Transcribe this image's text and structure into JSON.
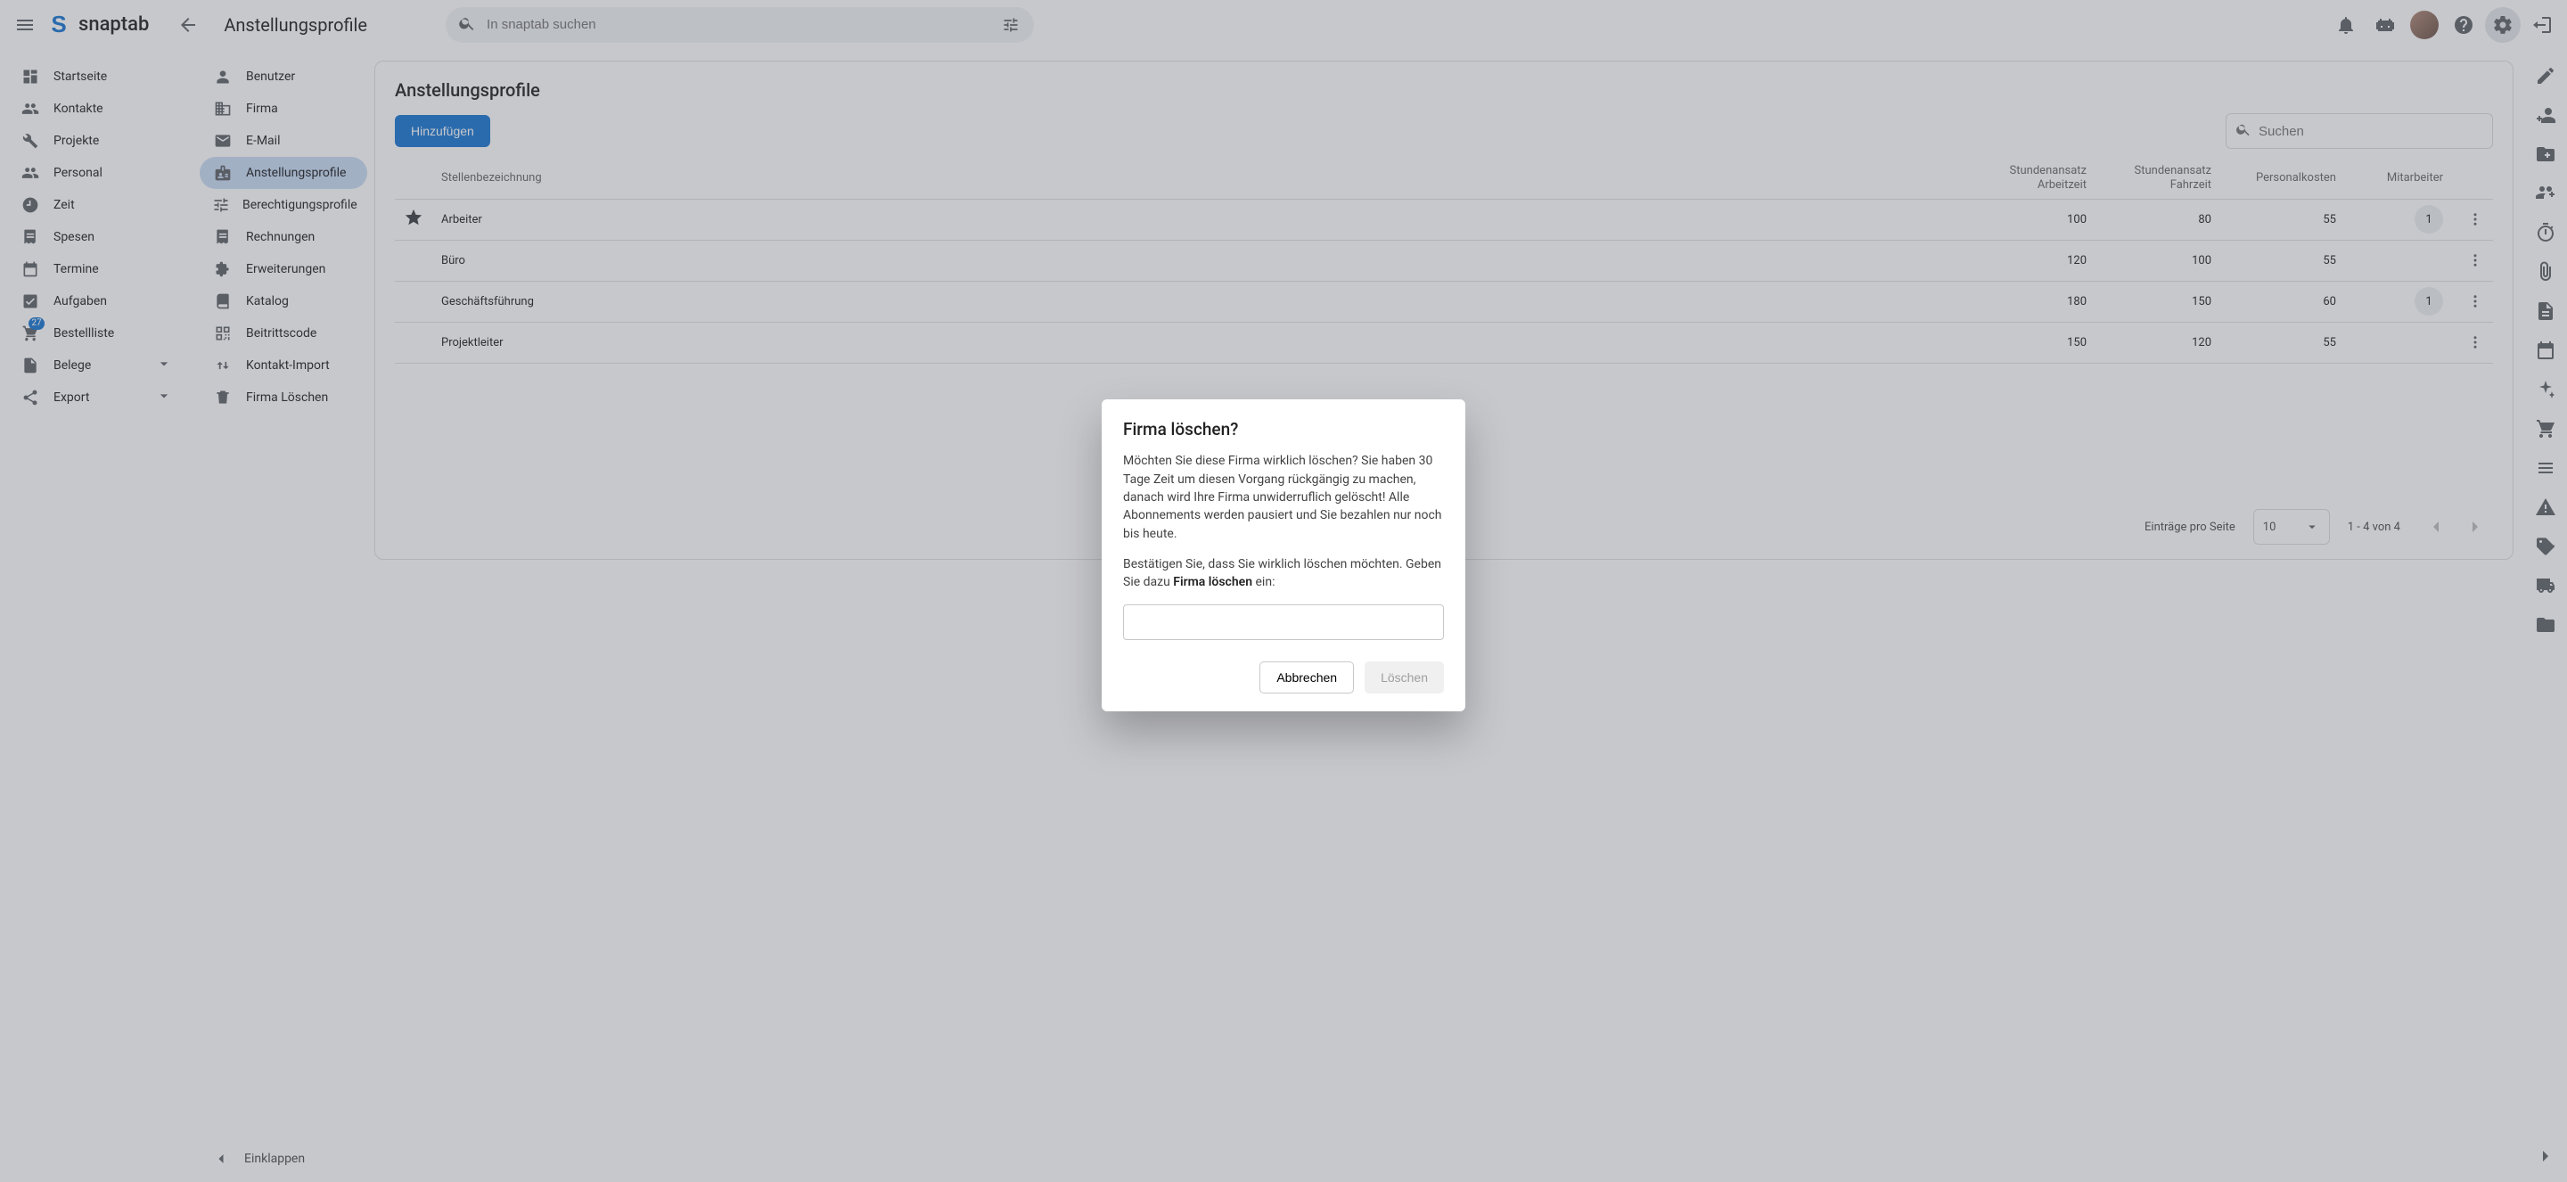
{
  "brand": {
    "word": "snaptab"
  },
  "topbar": {
    "page_title": "Anstellungsprofile",
    "search_placeholder": "In snaptab suchen"
  },
  "nav1": {
    "items": [
      {
        "label": "Startseite"
      },
      {
        "label": "Kontakte"
      },
      {
        "label": "Projekte"
      },
      {
        "label": "Personal"
      },
      {
        "label": "Zeit"
      },
      {
        "label": "Spesen"
      },
      {
        "label": "Termine"
      },
      {
        "label": "Aufgaben"
      },
      {
        "label": "Bestellliste",
        "badge": "27"
      },
      {
        "label": "Belege",
        "expandable": true
      },
      {
        "label": "Export",
        "expandable": true
      }
    ]
  },
  "nav2": {
    "items": [
      {
        "label": "Benutzer"
      },
      {
        "label": "Firma"
      },
      {
        "label": "E-Mail"
      },
      {
        "label": "Anstellungsprofile",
        "selected": true
      },
      {
        "label": "Berechtigungsprofile"
      },
      {
        "label": "Rechnungen"
      },
      {
        "label": "Erweiterungen"
      },
      {
        "label": "Katalog"
      },
      {
        "label": "Beitrittscode"
      },
      {
        "label": "Kontakt-Import"
      },
      {
        "label": "Firma Löschen"
      }
    ],
    "collapse_label": "Einklappen"
  },
  "content": {
    "heading": "Anstellungsprofile",
    "add_button": "Hinzufügen",
    "search_placeholder": "Suchen",
    "columns": {
      "title": "Stellenbezeichnung",
      "rate_work": "Stundenansatz\nArbeitzeit",
      "rate_drive": "Stundenansatz\nFahrzeit",
      "cost": "Personalkosten",
      "employees": "Mitarbeiter"
    },
    "rows": [
      {
        "starred": true,
        "title": "Arbeiter",
        "rate_work": "100",
        "rate_drive": "80",
        "cost": "55",
        "employees": "1"
      },
      {
        "starred": false,
        "title": "Büro",
        "rate_work": "120",
        "rate_drive": "100",
        "cost": "55",
        "employees": ""
      },
      {
        "starred": false,
        "title": "Geschäftsführung",
        "rate_work": "180",
        "rate_drive": "150",
        "cost": "60",
        "employees": "1"
      },
      {
        "starred": false,
        "title": "Projektleiter",
        "rate_work": "150",
        "rate_drive": "120",
        "cost": "55",
        "employees": ""
      }
    ],
    "paginator": {
      "items_label": "Einträge pro Seite",
      "page_size": "10",
      "range_label": "1 - 4 von 4"
    }
  },
  "dialog": {
    "title": "Firma löschen?",
    "body1": "Möchten Sie diese Firma wirklich löschen? Sie haben 30 Tage Zeit um diesen Vorgang rückgängig zu machen, danach wird Ihre Firma unwiderruflich gelöscht! Alle Abonnements werden pausiert und Sie bezahlen nur noch bis heute.",
    "body2_pre": "Bestätigen Sie, dass Sie wirklich löschen möchten. Geben Sie dazu ",
    "body2_bold": "Firma löschen",
    "body2_post": " ein:",
    "cancel": "Abbrechen",
    "confirm": "Löschen"
  }
}
